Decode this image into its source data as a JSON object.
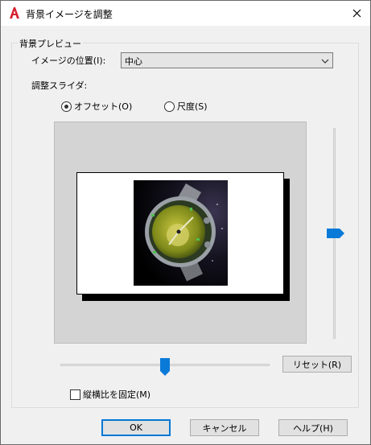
{
  "titlebar": {
    "title": "背景イメージを調整",
    "app_icon": "autocad-logo-icon",
    "close_icon": "close-icon"
  },
  "group": {
    "legend": "背景プレビュー",
    "position_label": "イメージの位置(I):",
    "position_value": "中心",
    "slider_label": "調整スライダ:",
    "radio_offset": "オフセット(O)",
    "radio_scale": "尺度(S)",
    "selected_mode": "offset",
    "vertical_slider": 0.5,
    "horizontal_slider": 0.5,
    "reset_label": "リセット(R)",
    "aspect_lock_label": "縦横比を固定(M)",
    "aspect_lock_checked": false
  },
  "footer": {
    "ok_label": "OK",
    "cancel_label": "キャンセル",
    "help_label": "ヘルプ(H)"
  },
  "colors": {
    "accent": "#0078d7",
    "preview_bg": "#d4d4d4",
    "slider_thumb": "#0a7ad8"
  }
}
